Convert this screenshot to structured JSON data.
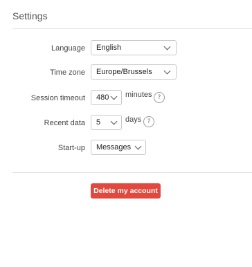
{
  "header": {
    "title": "Settings"
  },
  "settings": {
    "language": {
      "label": "Language",
      "value": "English"
    },
    "timezone": {
      "label": "Time zone",
      "value": "Europe/Brussels"
    },
    "session_timeout": {
      "label": "Session timeout",
      "value": "480",
      "unit": "minutes",
      "help": "?"
    },
    "recent_data": {
      "label": "Recent data",
      "value": "5",
      "unit": "days",
      "help": "?"
    },
    "startup": {
      "label": "Start-up",
      "value": "Messages"
    }
  },
  "actions": {
    "delete_account_label": "Delete my account"
  },
  "colors": {
    "danger": "#e2483d",
    "border": "#c8c8c8",
    "divider": "#e2e2e2"
  },
  "icons": {
    "help": "help-icon",
    "dropdown": "chevron-down-icon"
  }
}
